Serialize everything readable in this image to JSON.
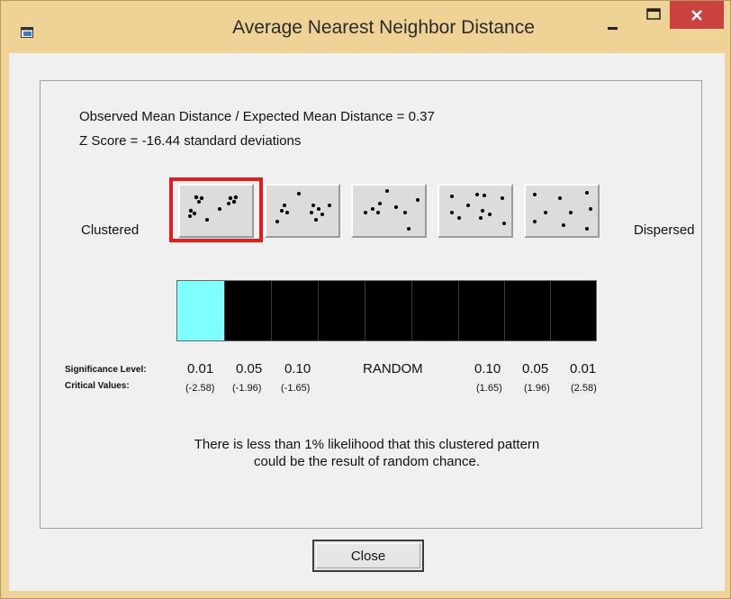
{
  "window": {
    "title": "Average Nearest Neighbor Distance"
  },
  "results": {
    "ratio_text": "Observed Mean Distance / Expected Mean Distance = 0.37",
    "zscore_text": "Z Score = -16.44 standard deviations"
  },
  "scale": {
    "left_label": "Clustered",
    "right_label": "Dispersed",
    "patterns": [
      "clustered",
      "somewhat-clustered",
      "random",
      "somewhat-dispersed",
      "dispersed"
    ],
    "selected_pattern_index": 0,
    "bar_segment_count": 9,
    "active_segment_index": 0
  },
  "significance": {
    "significance_label": "Significance Level:",
    "critical_label": "Critical Values:",
    "levels": [
      "0.01",
      "0.05",
      "0.10",
      "RANDOM",
      "0.10",
      "0.05",
      "0.01"
    ],
    "critical_values": [
      "(-2.58)",
      "(-1.96)",
      "(-1.65)",
      "",
      "(1.65)",
      "(1.96)",
      "(2.58)"
    ]
  },
  "message": {
    "line1": "There is less than 1% likelihood that this clustered pattern",
    "line2": "could be the result of random chance."
  },
  "buttons": {
    "close_label": "Close"
  },
  "colors": {
    "active_segment": "#80ffff",
    "selection": "#e41e1e",
    "bar": "#000000",
    "frame": "#efd396",
    "close_button": "#c9423f"
  },
  "icons": {
    "app": "dialog-icon",
    "minimize": "minimize-icon",
    "maximize": "maximize-icon",
    "close": "close-icon"
  }
}
